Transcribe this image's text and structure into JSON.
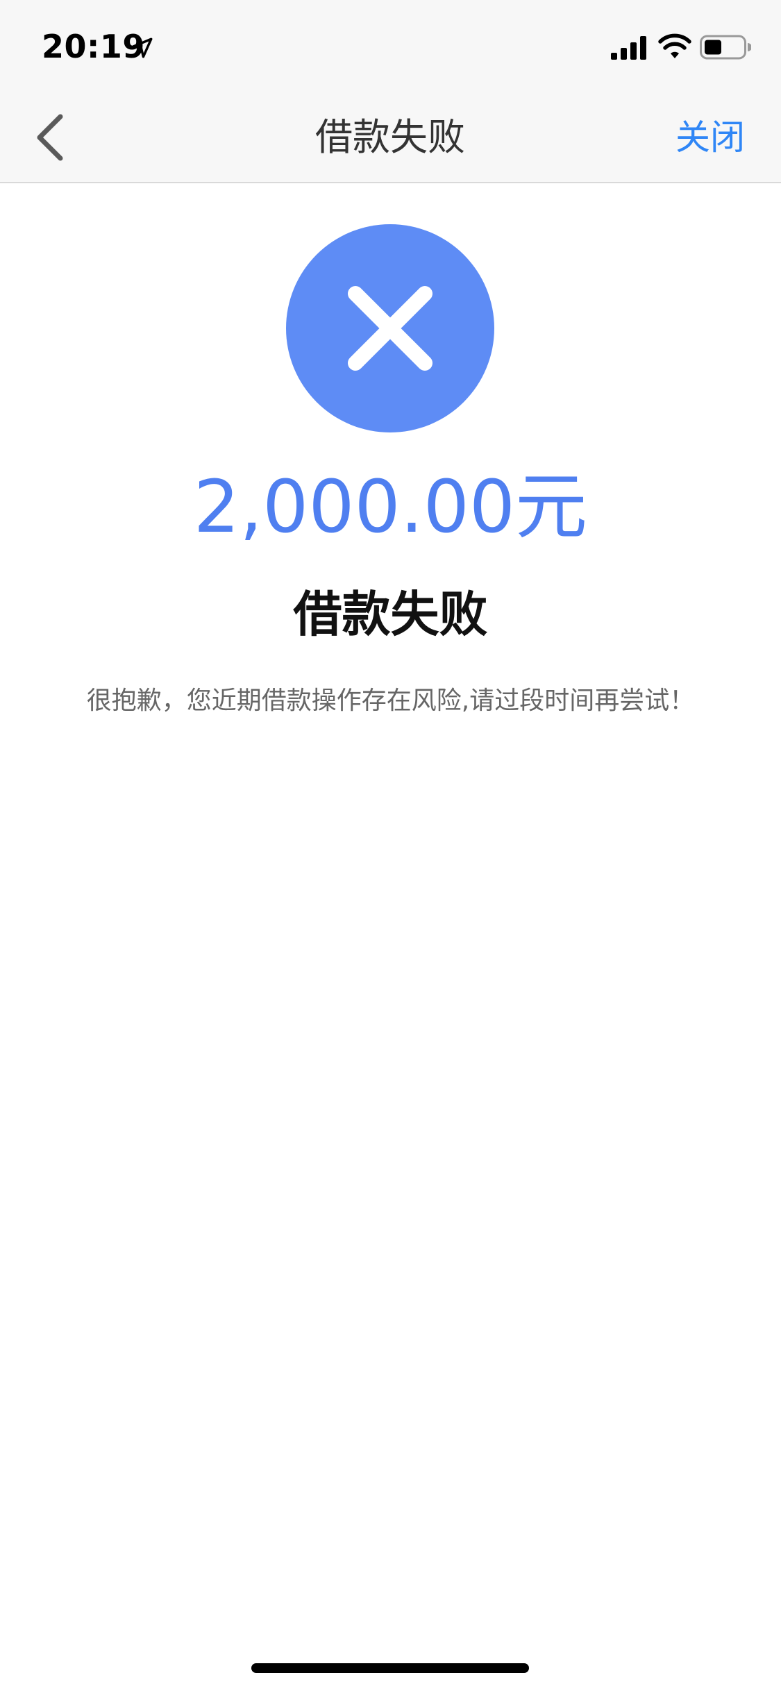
{
  "status_bar": {
    "time": "20:19",
    "icons": [
      "location-arrow-icon",
      "cellular-signal-icon",
      "wifi-icon",
      "battery-icon"
    ],
    "battery_level": 0.4
  },
  "nav_bar": {
    "title": "借款失败",
    "close_label": "关闭",
    "back_icon": "chevron-left-icon"
  },
  "result": {
    "icon": "close-circle-icon",
    "amount": "2,000.00元",
    "title": "借款失败",
    "message": "很抱歉，您近期借款操作存在风险,请过段时间再尝试！"
  },
  "colors": {
    "accent": "#5e8cf5",
    "amount_text": "#4f7ff0",
    "link": "#2f86f6",
    "nav_bg": "#f7f7f7"
  }
}
